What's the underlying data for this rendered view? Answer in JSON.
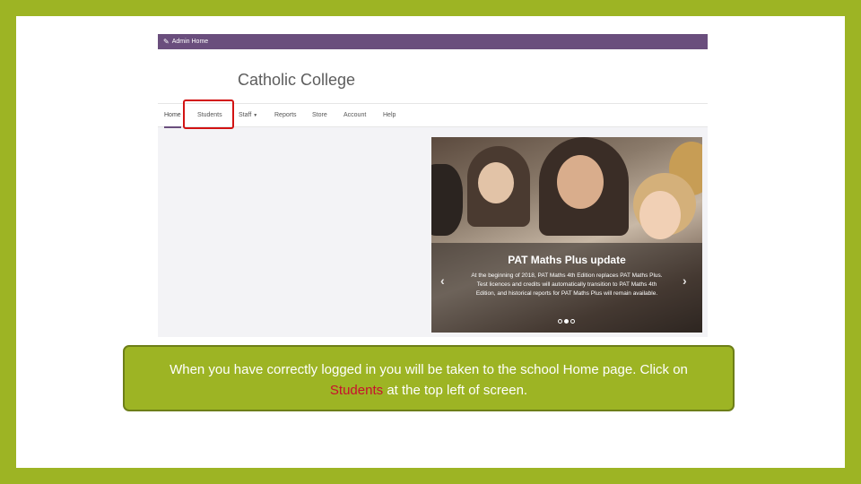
{
  "admin_bar": {
    "label": "Admin Home",
    "icon": "wrench-icon"
  },
  "header": {
    "school_name": "Catholic College"
  },
  "nav": {
    "items": [
      {
        "label": "Home",
        "active": true
      },
      {
        "label": "Students"
      },
      {
        "label": "Staff",
        "dropdown": true
      },
      {
        "label": "Reports"
      },
      {
        "label": "Store"
      },
      {
        "label": "Account"
      },
      {
        "label": "Help"
      }
    ]
  },
  "carousel": {
    "title": "PAT Maths Plus update",
    "body": "At the beginning of 2018, PAT Maths 4th Edition replaces PAT Maths Plus. Test licences and credits will automatically transition to PAT Maths 4th Edition, and historical reports for PAT Maths Plus will remain available.",
    "prev_icon": "chevron-left-icon",
    "next_icon": "chevron-right-icon",
    "slide_count": 3,
    "active_slide": 2
  },
  "callout": {
    "text_before": "When you have correctly logged in you will be taken to the school Home page. Click on",
    "highlight": "Students",
    "text_after": "at the top left of screen."
  },
  "colors": {
    "background": "#9db424",
    "admin_bar": "#6a4e7d",
    "highlight_box": "#d21313",
    "highlight_text": "#c8102e"
  }
}
